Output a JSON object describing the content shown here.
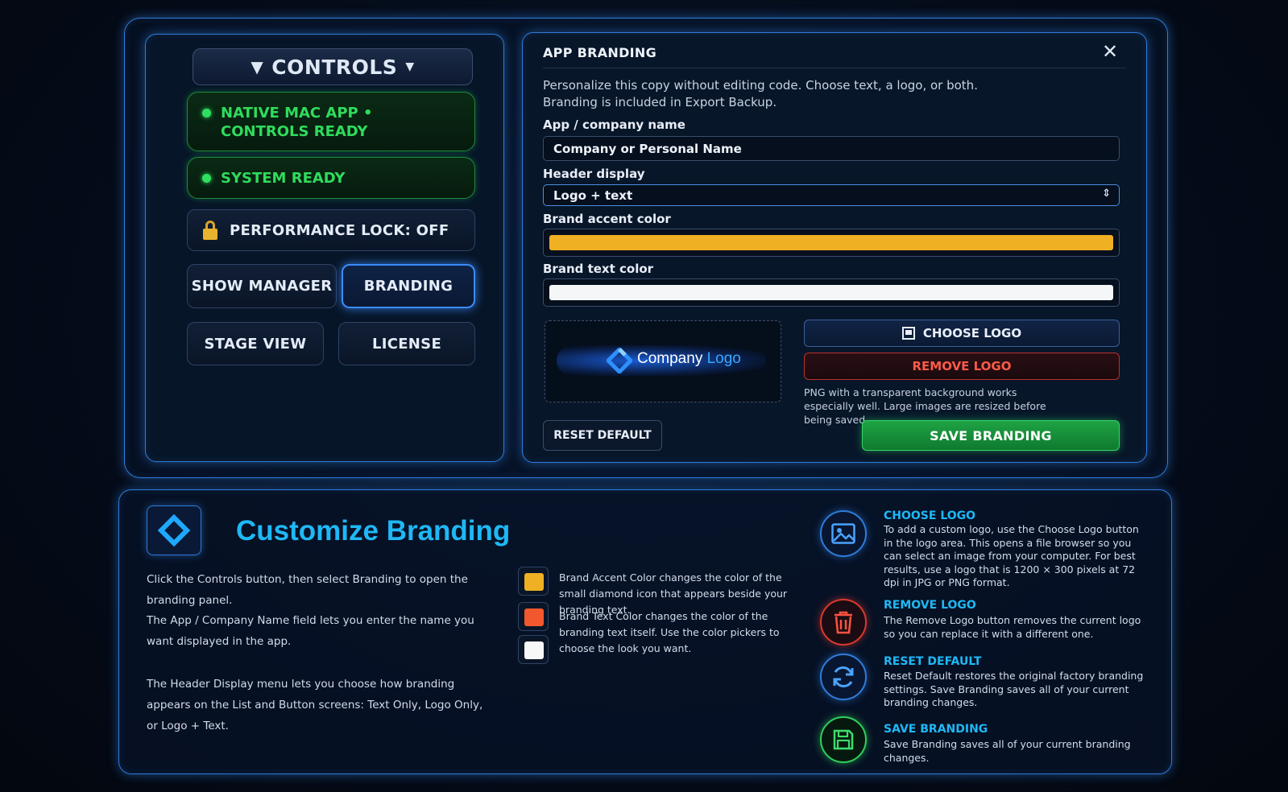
{
  "controls": {
    "title": "CONTROLS",
    "status_native": "NATIVE MAC APP • CONTROLS READY",
    "status_system": "SYSTEM READY",
    "performance_lock": "PERFORMANCE LOCK: OFF",
    "show_manager": "SHOW MANAGER",
    "branding": "BRANDING",
    "stage_view": "STAGE VIEW",
    "license": "LICENSE"
  },
  "branding_panel": {
    "title": "APP BRANDING",
    "close_glyph": "✕",
    "description_line1": "Personalize this copy without editing code. Choose text, a logo, or both.",
    "description_line2": "Branding is included in Export Backup.",
    "name_label": "App / company name",
    "name_value": "Company or Personal Name",
    "header_label": "Header display",
    "header_value": "Logo + text",
    "accent_label": "Brand accent color",
    "accent_color": "#f0b023",
    "text_color_label": "Brand text color",
    "text_color": "#f4f6f8",
    "logo_preview_word1": "Company",
    "logo_preview_word2": "Logo",
    "choose_logo": "CHOOSE LOGO",
    "remove_logo": "REMOVE LOGO",
    "logo_hint": "PNG with a transparent background works especially well. Large images are resized before being saved.",
    "reset_default": "RESET DEFAULT",
    "save_branding": "SAVE BRANDING"
  },
  "info": {
    "title": "Customize Branding",
    "para1": "Click the Controls button, then select Branding to open the branding panel.",
    "para2": "The App / Company Name field lets you enter the name you want displayed in the app.",
    "para3": "The Header Display menu lets you choose how branding appears on the List and Button screens: Text Only, Logo Only, or Logo + Text.",
    "swatch_colors": [
      "#f0b023",
      "#f2582e",
      "#f7f7f7"
    ],
    "accent_text": "Brand Accent Color changes the color of the small diamond icon that appears beside your branding text.",
    "textcolor_text": "Brand Text Color changes the color of the branding text itself. Use the color pickers to choose the look you want.",
    "features": [
      {
        "title": "CHOOSE LOGO",
        "body": "To add a custom logo, use the Choose Logo button in the logo area. This opens a file browser so you can select an image from your computer. For best results, use a logo that is 1200 × 300 pixels at 72 dpi in JPG or PNG format.",
        "icon": "image-icon"
      },
      {
        "title": "REMOVE LOGO",
        "body": "The Remove Logo button removes the current logo so you can replace it with a different one.",
        "icon": "trash-icon"
      },
      {
        "title": "RESET DEFAULT",
        "body": "Reset Default restores the original factory branding settings. Save Branding saves all of your current branding changes.",
        "icon": "refresh-icon"
      },
      {
        "title": "SAVE BRANDING",
        "body": "Save Branding saves all of your current branding changes.",
        "icon": "floppy-disk-icon"
      }
    ]
  }
}
